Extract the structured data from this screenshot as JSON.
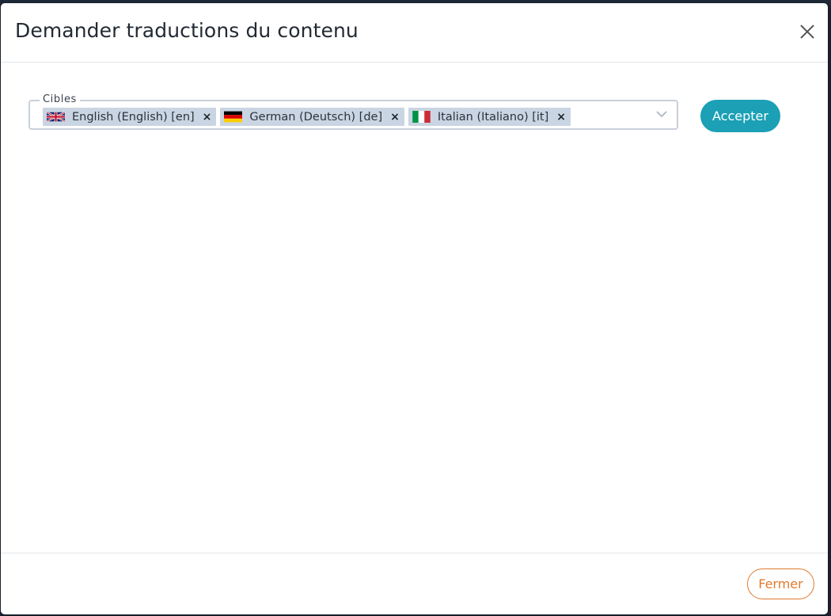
{
  "modal": {
    "title": "Demander traductions du contenu",
    "close_icon": "close-icon"
  },
  "targets": {
    "legend": "Cibles",
    "chips": [
      {
        "label": "English (English) [en]",
        "flag": "uk-flag-icon"
      },
      {
        "label": "German (Deutsch) [de]",
        "flag": "germany-flag-icon"
      },
      {
        "label": "Italian (Italiano) [it]",
        "flag": "italy-flag-icon"
      }
    ],
    "remove_glyph": "×",
    "caret_icon": "chevron-down-icon"
  },
  "actions": {
    "accept_label": "Accepter",
    "close_label": "Fermer"
  },
  "colors": {
    "accent_teal": "#1ba0b5",
    "accent_orange": "#e07a2f",
    "chip_bg": "#c9d5e2"
  }
}
